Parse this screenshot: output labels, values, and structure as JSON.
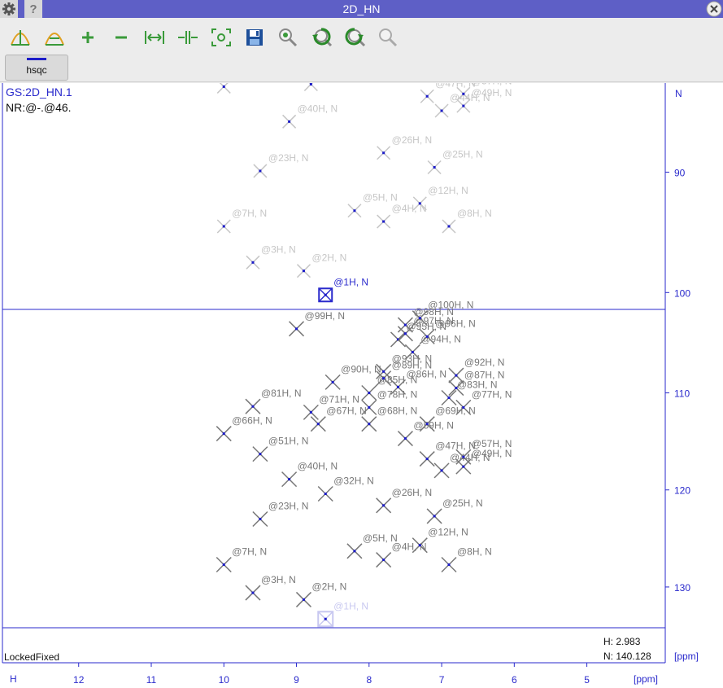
{
  "window": {
    "title": "2D_HN"
  },
  "icons": {
    "gear": "gear-icon",
    "help": "help-icon",
    "close": "close-icon"
  },
  "toolbar": {
    "tools": [
      "peak-pick-icon",
      "peak-pick-region-icon",
      "zoom-in-icon",
      "zoom-out-icon",
      "expand-horizontal-icon",
      "contract-horizontal-icon",
      "fit-view-icon",
      "save-icon",
      "zoom-pointer-icon",
      "undo-zoom-icon",
      "redo-zoom-icon",
      "zoom-reset-icon"
    ],
    "hsqc_label": "hsqc"
  },
  "plot": {
    "header_line1": "GS:2D_HN.1",
    "header_line2": "NR:@-.@46.",
    "footer_left": "LockedFixed",
    "cursor_h": "H: 2.983",
    "cursor_n": "N: 140.128",
    "ppm_unit_right": "[ppm]",
    "ppm_unit_bottom": "[ppm]",
    "h_axis_label": "H",
    "n_top_label": "N",
    "colors": {
      "axis": "#2a2acc",
      "bg": "#ffffff",
      "gray": "#777777",
      "light": "#c6c6c6",
      "highlight": "#2a2acc",
      "cluster": "#1c1cc8"
    }
  },
  "chart_data": {
    "type": "scatter",
    "x_axis": {
      "label": "H",
      "unit": "[ppm]",
      "ticks": [
        12,
        11,
        10,
        9,
        8,
        7,
        6,
        5
      ],
      "reversed": true,
      "range": [
        13.05,
        3.92
      ]
    },
    "y_axis": {
      "label": "N",
      "unit": "[ppm]",
      "ticks": [
        90,
        100,
        110,
        120,
        130
      ],
      "reversed": true
    },
    "cursor": {
      "H": 2.983,
      "N": 140.128
    },
    "selected_peak": "@1H, N",
    "lower_panel": {
      "y_range": [
        101.4,
        134.2
      ],
      "peaks": [
        {
          "label": "@1H, N",
          "H": 8.6,
          "N": 133.3
        },
        {
          "label": "@2H, N",
          "H": 8.9,
          "N": 131.3
        },
        {
          "label": "@3H, N",
          "H": 9.6,
          "N": 130.6
        },
        {
          "label": "@4H, N",
          "H": 7.8,
          "N": 127.2
        },
        {
          "label": "@5H, N",
          "H": 8.2,
          "N": 126.3
        },
        {
          "label": "@7H, N",
          "H": 10.0,
          "N": 127.7
        },
        {
          "label": "@8H, N",
          "H": 6.9,
          "N": 127.7
        },
        {
          "label": "@12H, N",
          "H": 7.3,
          "N": 125.7
        },
        {
          "label": "@23H, N",
          "H": 9.5,
          "N": 123.0
        },
        {
          "label": "@25H, N",
          "H": 7.1,
          "N": 122.7
        },
        {
          "label": "@26H, N",
          "H": 7.8,
          "N": 121.6
        },
        {
          "label": "@32H, N",
          "H": 8.6,
          "N": 120.4
        },
        {
          "label": "@40H, N",
          "H": 9.1,
          "N": 118.9
        },
        {
          "label": "@44H, N",
          "H": 7.0,
          "N": 118.0
        },
        {
          "label": "@47H, N",
          "H": 7.2,
          "N": 116.8
        },
        {
          "label": "@49H, N",
          "H": 6.7,
          "N": 117.6
        },
        {
          "label": "@51H, N",
          "H": 9.5,
          "N": 116.3
        },
        {
          "label": "@57H, N",
          "H": 6.7,
          "N": 116.6
        },
        {
          "label": "@59H, N",
          "H": 7.5,
          "N": 114.7
        },
        {
          "label": "@66H, N",
          "H": 10.0,
          "N": 114.2
        },
        {
          "label": "@67H, N",
          "H": 8.7,
          "N": 113.2
        },
        {
          "label": "@68H, N",
          "H": 8.0,
          "N": 113.2
        },
        {
          "label": "@69H, N",
          "H": 7.2,
          "N": 113.2
        },
        {
          "label": "@71H, N",
          "H": 8.8,
          "N": 112.0
        },
        {
          "label": "@77H, N",
          "H": 6.7,
          "N": 111.5
        },
        {
          "label": "@78H, N",
          "H": 8.0,
          "N": 111.5
        },
        {
          "label": "@81H, N",
          "H": 9.6,
          "N": 111.4
        },
        {
          "label": "@83H, N",
          "H": 6.9,
          "N": 110.5
        },
        {
          "label": "@85H, N",
          "H": 8.0,
          "N": 110.0
        },
        {
          "label": "@86H, N",
          "H": 7.6,
          "N": 109.4
        },
        {
          "label": "@87H, N",
          "H": 6.8,
          "N": 109.5
        },
        {
          "label": "@89H, N",
          "H": 7.8,
          "N": 108.5
        },
        {
          "label": "@90H, N",
          "H": 8.5,
          "N": 108.9
        },
        {
          "label": "@92H, N",
          "H": 6.8,
          "N": 108.2
        },
        {
          "label": "@93H, N",
          "H": 7.8,
          "N": 107.8
        },
        {
          "label": "@94H, N",
          "H": 7.4,
          "N": 105.8
        },
        {
          "label": "@95H, N",
          "H": 7.6,
          "N": 104.5
        },
        {
          "label": "@96H, N",
          "H": 7.2,
          "N": 104.2
        },
        {
          "label": "@97H, N",
          "H": 7.5,
          "N": 103.9
        },
        {
          "label": "@98H, N",
          "H": 7.5,
          "N": 103.0
        },
        {
          "label": "@99H, N",
          "H": 9.0,
          "N": 103.4
        },
        {
          "label": "@100H, N",
          "H": 7.3,
          "N": 102.3
        }
      ]
    },
    "upper_panel": {
      "y_range": [
        82.6,
        101.4
      ],
      "peaks": [
        {
          "label": "@1H, N",
          "H": 8.6,
          "N": 100.2
        },
        {
          "label": "@2H, N",
          "H": 8.9,
          "N": 98.2
        },
        {
          "label": "@3H, N",
          "H": 9.6,
          "N": 97.5
        },
        {
          "label": "@4H, N",
          "H": 7.8,
          "N": 94.1
        },
        {
          "label": "@5H, N",
          "H": 8.2,
          "N": 93.2
        },
        {
          "label": "@7H, N",
          "H": 10.0,
          "N": 94.5
        },
        {
          "label": "@8H, N",
          "H": 6.9,
          "N": 94.5
        },
        {
          "label": "@12H, N",
          "H": 7.3,
          "N": 92.6
        },
        {
          "label": "@23H, N",
          "H": 9.5,
          "N": 89.9
        },
        {
          "label": "@25H, N",
          "H": 7.1,
          "N": 89.6
        },
        {
          "label": "@26H, N",
          "H": 7.8,
          "N": 88.4
        },
        {
          "label": "@40H, N",
          "H": 9.1,
          "N": 85.8
        },
        {
          "label": "@44H, N",
          "H": 7.0,
          "N": 84.9
        },
        {
          "label": "@47H, N",
          "H": 7.2,
          "N": 83.7
        },
        {
          "label": "@49H, N",
          "H": 6.7,
          "N": 84.5
        },
        {
          "label": "@57H, N",
          "H": 6.7,
          "N": 83.5
        },
        {
          "label": "@66H, N",
          "H": 10.0,
          "N": 82.9
        },
        {
          "label": "@71H, N",
          "H": 8.8,
          "N": 82.7
        }
      ]
    }
  }
}
